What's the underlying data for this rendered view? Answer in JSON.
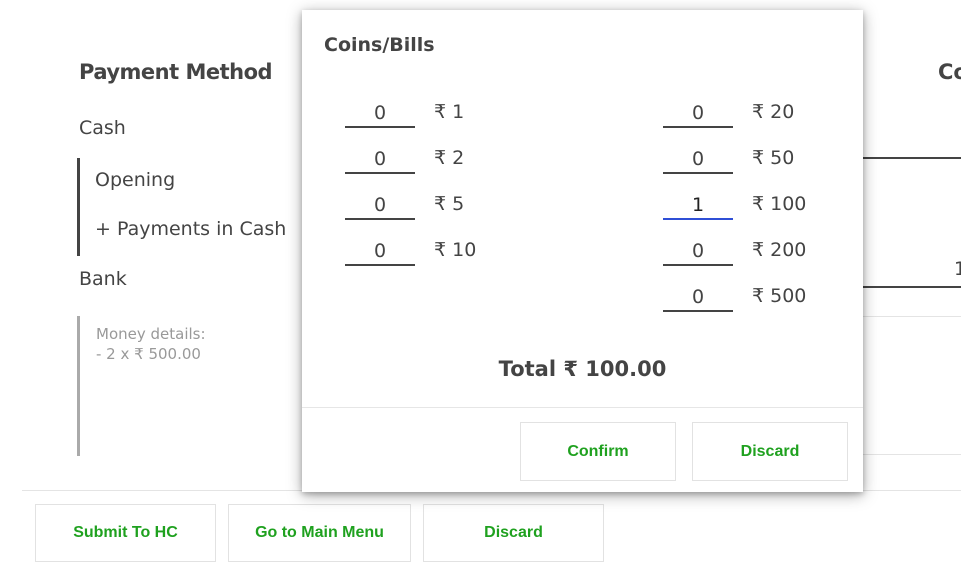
{
  "background": {
    "payment_method_heading": "Payment Method",
    "cash_label": "Cash",
    "opening_label": "Opening",
    "payments_in_cash_label": "+ Payments in Cash",
    "bank_label": "Bank",
    "money_details": "Money details:\n- 2 x ₹ 500.00",
    "right_heading_partial": "Co",
    "right_value_partial": "1"
  },
  "footer": {
    "submit_label": "Submit To HC",
    "main_menu_label": "Go to Main Menu",
    "discard_label": "Discard"
  },
  "modal": {
    "title": "Coins/Bills",
    "left_column": [
      {
        "count": "0",
        "label": "₹ 1"
      },
      {
        "count": "0",
        "label": "₹ 2"
      },
      {
        "count": "0",
        "label": "₹ 5"
      },
      {
        "count": "0",
        "label": "₹ 10"
      }
    ],
    "right_column": [
      {
        "count": "0",
        "label": "₹ 20"
      },
      {
        "count": "0",
        "label": "₹ 50"
      },
      {
        "count": "1",
        "label": "₹ 100"
      },
      {
        "count": "0",
        "label": "₹ 200"
      },
      {
        "count": "0",
        "label": "₹ 500"
      }
    ],
    "total_text": "Total ₹ 100.00",
    "confirm_label": "Confirm",
    "discard_label": "Discard"
  },
  "colors": {
    "accent_green": "#1fa11f",
    "active_input_underline": "#2f4fd6"
  }
}
